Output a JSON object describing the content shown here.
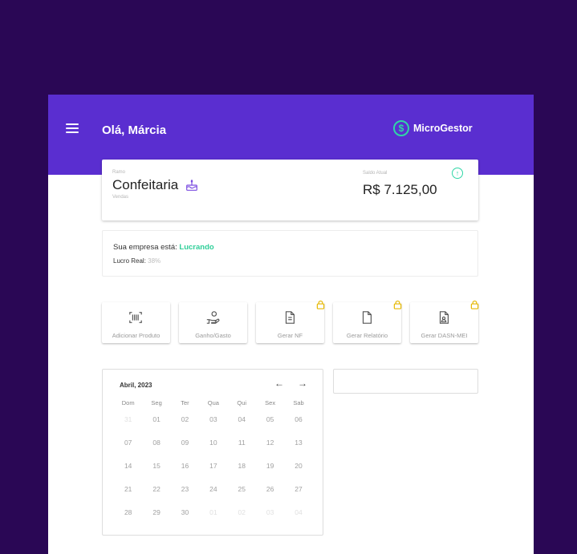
{
  "header": {
    "greeting": "Olá, Márcia",
    "brand": "MicroGestor"
  },
  "summary": {
    "ramo_label": "Ramo",
    "ramo_value": "Confeitaria",
    "ramo_sub": "Vendas",
    "saldo_label": "Saldo Atual",
    "saldo_value": "R$ 7.125,00"
  },
  "status": {
    "prefix": "Sua empresa está:",
    "value": "Lucrando",
    "lucro_label": "Lucro Real:",
    "lucro_value": "38%"
  },
  "actions": [
    {
      "label": "Adicionar Produto",
      "icon": "barcode-icon",
      "locked": false
    },
    {
      "label": "Ganho/Gasto",
      "icon": "hand-coins-icon",
      "locked": false
    },
    {
      "label": "Gerar NF",
      "icon": "document-icon",
      "locked": true
    },
    {
      "label": "Gerar Relatório",
      "icon": "file-icon",
      "locked": true
    },
    {
      "label": "Gerar DASN-MEI",
      "icon": "file-user-icon",
      "locked": true
    }
  ],
  "calendar": {
    "month": "Abril, 2023",
    "prev": "←",
    "next": "→",
    "weekdays": [
      "Dom",
      "Seg",
      "Ter",
      "Qua",
      "Qui",
      "Sex",
      "Sab"
    ],
    "weeks": [
      [
        "31",
        "01",
        "02",
        "03",
        "04",
        "05",
        "06"
      ],
      [
        "07",
        "08",
        "09",
        "10",
        "11",
        "12",
        "13"
      ],
      [
        "14",
        "15",
        "16",
        "17",
        "18",
        "19",
        "20"
      ],
      [
        "21",
        "22",
        "23",
        "24",
        "25",
        "26",
        "27"
      ],
      [
        "28",
        "29",
        "30",
        "01",
        "02",
        "03",
        "04"
      ]
    ]
  },
  "colors": {
    "background": "#2a0755",
    "header": "#5a2ed0",
    "accent_green": "#2fd6a6",
    "lock_yellow": "#e6b800"
  }
}
